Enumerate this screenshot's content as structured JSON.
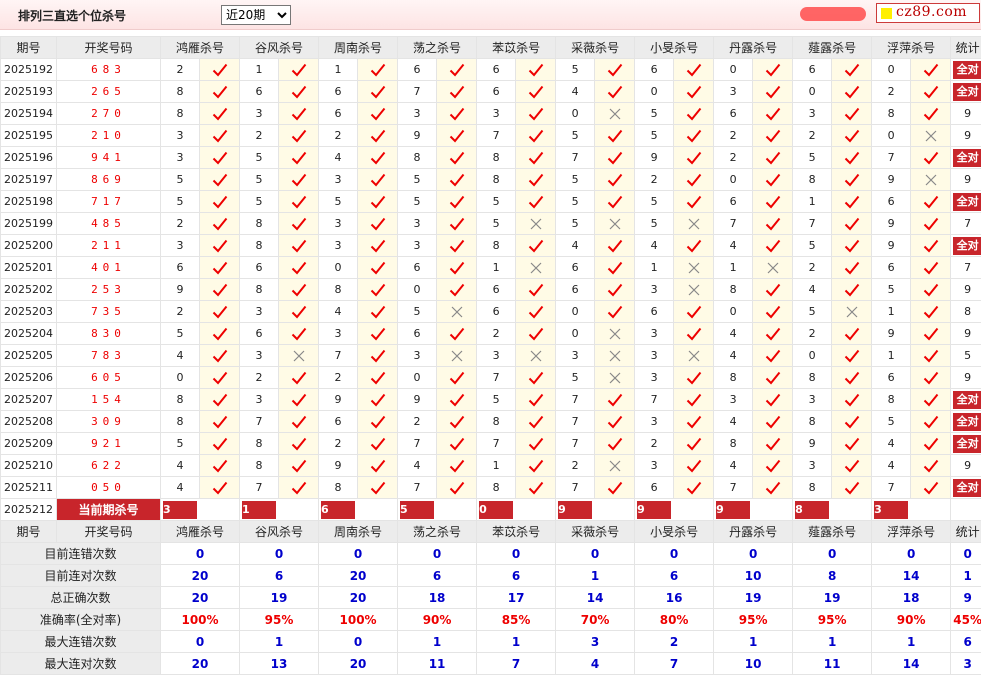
{
  "header": {
    "title": "排列三直选个位杀号",
    "range_select": "近20期",
    "range_options": [
      "近20期"
    ],
    "logo_text": "cz89.com"
  },
  "columns": {
    "period": "期号",
    "draw": "开奖号码",
    "experts": [
      "鸿雁杀号",
      "谷风杀号",
      "周南杀号",
      "荡之杀号",
      "苯苡杀号",
      "采薇杀号",
      "小旻杀号",
      "丹露杀号",
      "薤露杀号",
      "浮萍杀号"
    ],
    "stats": "统计"
  },
  "rows": [
    {
      "period": "2025192",
      "draw": "683",
      "kills": [
        2,
        1,
        1,
        6,
        6,
        5,
        6,
        0,
        6,
        0
      ],
      "ok": [
        1,
        1,
        1,
        1,
        1,
        1,
        1,
        1,
        1,
        1
      ],
      "stat": "全对"
    },
    {
      "period": "2025193",
      "draw": "265",
      "kills": [
        8,
        6,
        6,
        7,
        6,
        4,
        0,
        3,
        0,
        2
      ],
      "ok": [
        1,
        1,
        1,
        1,
        1,
        1,
        1,
        1,
        1,
        1
      ],
      "stat": "全对"
    },
    {
      "period": "2025194",
      "draw": "270",
      "kills": [
        8,
        3,
        6,
        3,
        3,
        0,
        5,
        6,
        3,
        8
      ],
      "ok": [
        1,
        1,
        1,
        1,
        1,
        0,
        1,
        1,
        1,
        1
      ],
      "stat": "9"
    },
    {
      "period": "2025195",
      "draw": "210",
      "kills": [
        3,
        2,
        2,
        9,
        7,
        5,
        5,
        2,
        2,
        0
      ],
      "ok": [
        1,
        1,
        1,
        1,
        1,
        1,
        1,
        1,
        1,
        0
      ],
      "stat": "9"
    },
    {
      "period": "2025196",
      "draw": "941",
      "kills": [
        3,
        5,
        4,
        8,
        8,
        7,
        9,
        2,
        5,
        7
      ],
      "ok": [
        1,
        1,
        1,
        1,
        1,
        1,
        1,
        1,
        1,
        1
      ],
      "stat": "全对"
    },
    {
      "period": "2025197",
      "draw": "869",
      "kills": [
        5,
        5,
        3,
        5,
        8,
        5,
        2,
        0,
        8,
        9
      ],
      "ok": [
        1,
        1,
        1,
        1,
        1,
        1,
        1,
        1,
        1,
        0
      ],
      "stat": "9"
    },
    {
      "period": "2025198",
      "draw": "717",
      "kills": [
        5,
        5,
        5,
        5,
        5,
        5,
        5,
        6,
        1,
        6
      ],
      "ok": [
        1,
        1,
        1,
        1,
        1,
        1,
        1,
        1,
        1,
        1
      ],
      "stat": "全对"
    },
    {
      "period": "2025199",
      "draw": "485",
      "kills": [
        2,
        8,
        3,
        3,
        5,
        5,
        5,
        7,
        7,
        9
      ],
      "ok": [
        1,
        1,
        1,
        1,
        0,
        0,
        0,
        1,
        1,
        1
      ],
      "stat": "7"
    },
    {
      "period": "2025200",
      "draw": "211",
      "kills": [
        3,
        8,
        3,
        3,
        8,
        4,
        4,
        4,
        5,
        9
      ],
      "ok": [
        1,
        1,
        1,
        1,
        1,
        1,
        1,
        1,
        1,
        1
      ],
      "stat": "全对"
    },
    {
      "period": "2025201",
      "draw": "401",
      "kills": [
        6,
        6,
        0,
        6,
        1,
        6,
        1,
        1,
        2,
        6
      ],
      "ok": [
        1,
        1,
        1,
        1,
        0,
        1,
        0,
        0,
        1,
        1
      ],
      "stat": "7"
    },
    {
      "period": "2025202",
      "draw": "253",
      "kills": [
        9,
        8,
        8,
        0,
        6,
        6,
        3,
        8,
        4,
        5
      ],
      "ok": [
        1,
        1,
        1,
        1,
        1,
        1,
        0,
        1,
        1,
        1
      ],
      "stat": "9"
    },
    {
      "period": "2025203",
      "draw": "735",
      "kills": [
        2,
        3,
        4,
        5,
        6,
        0,
        6,
        0,
        5,
        1
      ],
      "ok": [
        1,
        1,
        1,
        0,
        1,
        1,
        1,
        1,
        0,
        1
      ],
      "stat": "8"
    },
    {
      "period": "2025204",
      "draw": "830",
      "kills": [
        5,
        6,
        3,
        6,
        2,
        0,
        3,
        4,
        2,
        9
      ],
      "ok": [
        1,
        1,
        1,
        1,
        1,
        0,
        1,
        1,
        1,
        1
      ],
      "stat": "9"
    },
    {
      "period": "2025205",
      "draw": "783",
      "kills": [
        4,
        3,
        7,
        3,
        3,
        3,
        3,
        4,
        0,
        1
      ],
      "ok": [
        1,
        0,
        1,
        0,
        0,
        0,
        0,
        1,
        1,
        1
      ],
      "stat": "5"
    },
    {
      "period": "2025206",
      "draw": "605",
      "kills": [
        0,
        2,
        2,
        0,
        7,
        5,
        3,
        8,
        8,
        6
      ],
      "ok": [
        1,
        1,
        1,
        1,
        1,
        0,
        1,
        1,
        1,
        1
      ],
      "stat": "9"
    },
    {
      "period": "2025207",
      "draw": "154",
      "kills": [
        8,
        3,
        9,
        9,
        5,
        7,
        7,
        3,
        3,
        8
      ],
      "ok": [
        1,
        1,
        1,
        1,
        1,
        1,
        1,
        1,
        1,
        1
      ],
      "stat": "全对"
    },
    {
      "period": "2025208",
      "draw": "309",
      "kills": [
        8,
        7,
        6,
        2,
        8,
        7,
        3,
        4,
        8,
        5
      ],
      "ok": [
        1,
        1,
        1,
        1,
        1,
        1,
        1,
        1,
        1,
        1
      ],
      "stat": "全对"
    },
    {
      "period": "2025209",
      "draw": "921",
      "kills": [
        5,
        8,
        2,
        7,
        7,
        7,
        2,
        8,
        9,
        4
      ],
      "ok": [
        1,
        1,
        1,
        1,
        1,
        1,
        1,
        1,
        1,
        1
      ],
      "stat": "全对"
    },
    {
      "period": "2025210",
      "draw": "622",
      "kills": [
        4,
        8,
        9,
        4,
        1,
        2,
        3,
        4,
        3,
        4
      ],
      "ok": [
        1,
        1,
        1,
        1,
        1,
        0,
        1,
        1,
        1,
        1
      ],
      "stat": "9"
    },
    {
      "period": "2025211",
      "draw": "050",
      "kills": [
        4,
        7,
        8,
        7,
        8,
        7,
        6,
        7,
        8,
        7
      ],
      "ok": [
        1,
        1,
        1,
        1,
        1,
        1,
        1,
        1,
        1,
        1
      ],
      "stat": "全对"
    }
  ],
  "current": {
    "period": "2025212",
    "label": "当前期杀号",
    "values": [
      "3",
      "1",
      "6",
      "5",
      "0",
      "9",
      "9",
      "9",
      "8",
      "3"
    ]
  },
  "stats": [
    {
      "label": "目前连错次数",
      "values": [
        "0",
        "0",
        "0",
        "0",
        "0",
        "0",
        "0",
        "0",
        "0",
        "0",
        "0"
      ],
      "red": false
    },
    {
      "label": "目前连对次数",
      "values": [
        "20",
        "6",
        "20",
        "6",
        "6",
        "1",
        "6",
        "10",
        "8",
        "14",
        "1"
      ],
      "red": false
    },
    {
      "label": "总正确次数",
      "values": [
        "20",
        "19",
        "20",
        "18",
        "17",
        "14",
        "16",
        "19",
        "19",
        "18",
        "9"
      ],
      "red": false
    },
    {
      "label": "准确率(全对率)",
      "values": [
        "100%",
        "95%",
        "100%",
        "90%",
        "85%",
        "70%",
        "80%",
        "95%",
        "95%",
        "90%",
        "45%"
      ],
      "red": true
    },
    {
      "label": "最大连错次数",
      "values": [
        "0",
        "1",
        "0",
        "1",
        "1",
        "3",
        "2",
        "1",
        "1",
        "1",
        "6"
      ],
      "red": false
    },
    {
      "label": "最大连对次数",
      "values": [
        "20",
        "13",
        "20",
        "11",
        "7",
        "4",
        "7",
        "10",
        "11",
        "14",
        "3"
      ],
      "red": false
    }
  ],
  "colors": {
    "accent": "#c8252b",
    "blue": "#0000cc",
    "red": "#e00000",
    "marker_bg": "#fffbe6"
  },
  "icons": {
    "ok": "check-icon",
    "fail": "cross-icon"
  }
}
